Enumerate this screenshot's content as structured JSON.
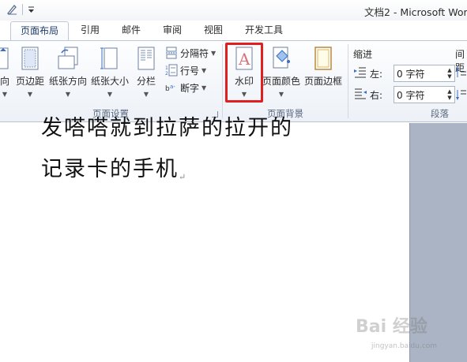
{
  "window": {
    "title": "文档2 - Microsoft Wor"
  },
  "tabs": [
    {
      "label": "页面布局",
      "active": true
    },
    {
      "label": "引用"
    },
    {
      "label": "邮件"
    },
    {
      "label": "审阅"
    },
    {
      "label": "视图"
    },
    {
      "label": "开发工具"
    }
  ],
  "ribbon": {
    "page_setup": {
      "label": "页面设置",
      "buttons": {
        "orientation": "向",
        "margins": "页边距",
        "paper_orientation": "纸张方向",
        "paper_size": "纸张大小",
        "columns": "分栏"
      },
      "small": {
        "breaks": "分隔符",
        "line_numbers": "行号",
        "hyphenation": "断字"
      }
    },
    "page_background": {
      "label": "页面背景",
      "buttons": {
        "watermark": "水印",
        "page_color": "页面颜色",
        "page_borders": "页面边框"
      }
    },
    "paragraph": {
      "label": "段落",
      "indent": {
        "heading": "缩进",
        "left_label": "左:",
        "left_value": "0 字符",
        "right_label": "右:",
        "right_value": "0 字符"
      },
      "spacing": {
        "heading": "间距"
      }
    }
  },
  "document": {
    "lines": [
      "发嗒嗒就到拉萨的拉开的",
      "记录卡的手机"
    ],
    "para_mark": "↵"
  },
  "watermark": {
    "brand": "Bai 经验",
    "url": "jingyan.baidu.com"
  },
  "colors": {
    "highlight": "#e02020",
    "ribbon_bg": "#edf1f7",
    "doc_bg": "#abb4c4"
  }
}
